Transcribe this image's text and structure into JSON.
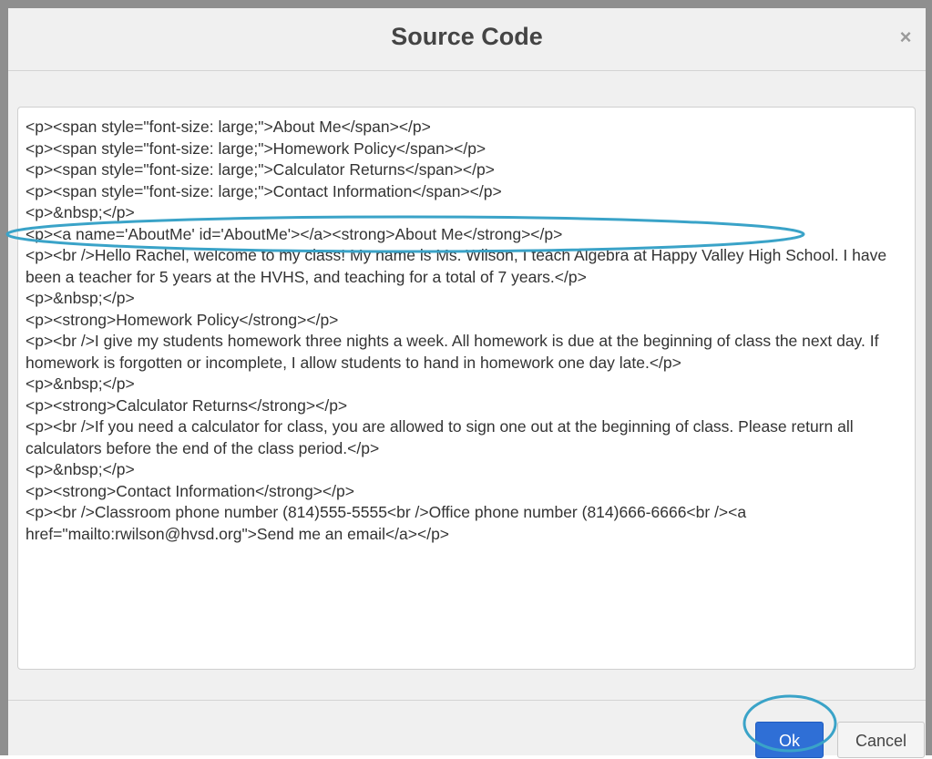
{
  "dialog": {
    "title": "Source Code",
    "close_icon": "close-icon",
    "close_glyph": "×"
  },
  "editor": {
    "content": "<p><span style=\"font-size: large;\">About Me</span></p>\n<p><span style=\"font-size: large;\">Homework Policy</span></p>\n<p><span style=\"font-size: large;\">Calculator Returns</span></p>\n<p><span style=\"font-size: large;\">Contact Information</span></p>\n<p>&nbsp;</p>\n<p><a name='AboutMe' id='AboutMe'></a><strong>About Me</strong></p>\n<p><br />Hello Rachel, welcome to my class! My name is Ms. Wilson, I teach Algebra at Happy Valley High School. I have been a teacher for 5 years at the HVHS, and teaching for a total of 7 years.</p>\n<p>&nbsp;</p>\n<p><strong>Homework Policy</strong></p>\n<p><br />I give my students homework three nights a week. All homework is due at the beginning of class the next day. If homework is forgotten or incomplete, I allow students to hand in homework one day late.</p>\n<p>&nbsp;</p>\n<p><strong>Calculator Returns</strong></p>\n<p><br />If you need a calculator for class, you are allowed to sign one out at the beginning of class. Please return all calculators before the end of the class period.</p>\n<p>&nbsp;</p>\n<p><strong>Contact Information</strong></p>\n<p><br />Classroom phone number (814)555-5555<br />Office phone number (814)666-6666<br /><a href=\"mailto:rwilson@hvsd.org\">Send me an email</a></p>"
  },
  "footer": {
    "ok_label": "Ok",
    "cancel_label": "Cancel"
  },
  "colors": {
    "annotation": "#3aa3c8",
    "ok_button": "#2f6fd6"
  }
}
